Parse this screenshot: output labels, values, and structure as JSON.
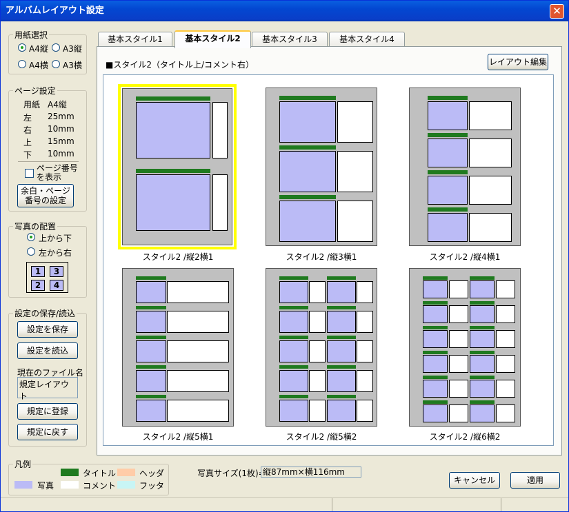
{
  "window": {
    "title": "アルバムレイアウト設定",
    "close": "✕"
  },
  "paper": {
    "legend": "用紙選択",
    "options": [
      {
        "label": "A4縦",
        "checked": true
      },
      {
        "label": "A3縦",
        "checked": false
      },
      {
        "label": "A4横",
        "checked": false
      },
      {
        "label": "A3横",
        "checked": false
      }
    ]
  },
  "page_settings": {
    "legend": "ページ設定",
    "rows": [
      {
        "k": "用紙",
        "v": "A4縦"
      },
      {
        "k": "左",
        "v": "25mm"
      },
      {
        "k": "右",
        "v": "10mm"
      },
      {
        "k": "上",
        "v": "15mm"
      },
      {
        "k": "下",
        "v": "10mm"
      }
    ],
    "show_page_number": {
      "line1": "ページ番号",
      "line2": "を表示",
      "checked": false
    },
    "margin_button": {
      "line1": "余白・ページ",
      "line2": "番号の設定"
    }
  },
  "arrangement": {
    "legend": "写真の配置",
    "options": [
      {
        "label": "上から下",
        "checked": true
      },
      {
        "label": "左から右",
        "checked": false
      }
    ],
    "order": [
      "1",
      "3",
      "2",
      "4"
    ]
  },
  "save_load": {
    "legend": "設定の保存/読込",
    "save": "設定を保存",
    "load": "設定を読込",
    "current_file_label": "現在のファイル名",
    "current_file": "規定レイアウト",
    "register": "規定に登録",
    "restore": "規定に戻す"
  },
  "tabs": [
    {
      "label": "基本スタイル1",
      "active": false
    },
    {
      "label": "基本スタイル2",
      "active": true
    },
    {
      "label": "基本スタイル3",
      "active": false
    },
    {
      "label": "基本スタイル4",
      "active": false
    }
  ],
  "style_header": "■スタイル2（タイトル上/コメント右）",
  "layout_edit": "レイアウト編集",
  "thumbnails": [
    "スタイル2 /縦2横1",
    "スタイル2 /縦3横1",
    "スタイル2 /縦4横1",
    "スタイル2 /縦5横1",
    "スタイル2 /縦5横2",
    "スタイル2 /縦6横2"
  ],
  "legend_box": {
    "legend": "凡例",
    "items": [
      {
        "label": "タイトル",
        "color": "#1f7a1f"
      },
      {
        "label": "ヘッダ",
        "color": "#ffcca8"
      },
      {
        "label": "写真",
        "color": "#bbbbf6"
      },
      {
        "label": "コメント",
        "color": "#ffffff"
      },
      {
        "label": "フッタ",
        "color": "#c8f5f5"
      }
    ]
  },
  "photo_size": {
    "label": "写真サイズ(1枚)=",
    "value": "縦87mm×横116mm"
  },
  "buttons": {
    "cancel": "キャンセル",
    "apply": "適用"
  }
}
